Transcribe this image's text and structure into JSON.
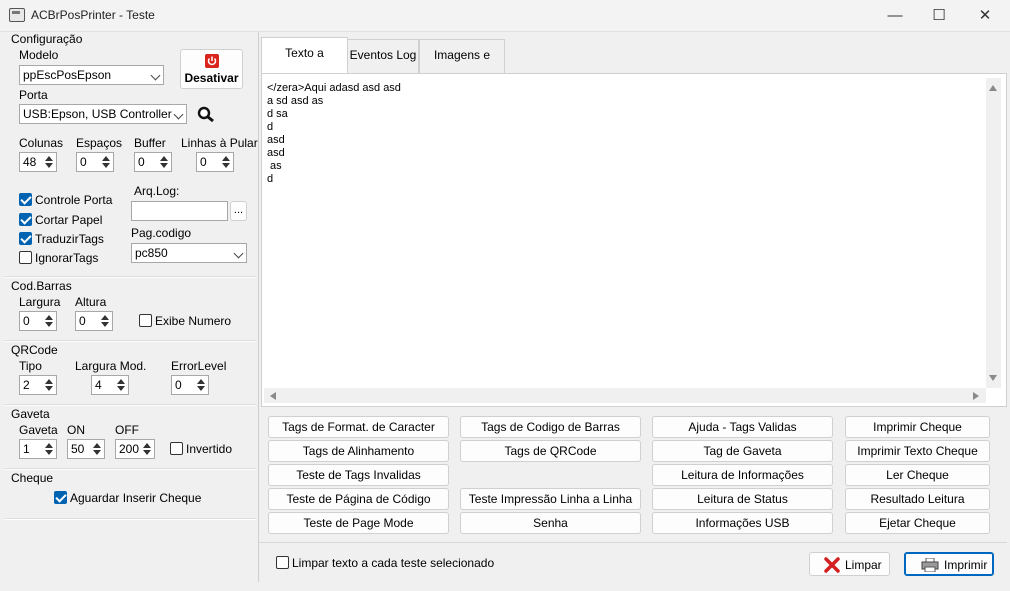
{
  "window": {
    "title": "ACBrPosPrinter - Teste",
    "minimize": "—",
    "maximize": "☐",
    "close": "✕"
  },
  "config": {
    "section_title": "Configuração",
    "modelo_label": "Modelo",
    "modelo_value": "ppEscPosEpson",
    "desativar_label": "Desativar",
    "porta_label": "Porta",
    "porta_value": "USB:Epson, USB Controller",
    "colunas_label": "Colunas",
    "colunas_value": "48",
    "espacos_label": "Espaços",
    "espacos_value": "0",
    "buffer_label": "Buffer",
    "buffer_value": "0",
    "linhas_label": "Linhas à Pular",
    "linhas_value": "0",
    "controle_porta": "Controle Porta",
    "cortar_papel": "Cortar Papel",
    "traduzir_tags": "TraduzirTags",
    "ignorar_tags": "IgnorarTags",
    "arqlog_label": "Arq.Log:",
    "arqlog_value": "",
    "browse_label": "...",
    "pagcodigo_label": "Pag.codigo",
    "pagcodigo_value": "pc850"
  },
  "codbarras": {
    "section_title": "Cod.Barras",
    "largura_label": "Largura",
    "largura_value": "0",
    "altura_label": "Altura",
    "altura_value": "0",
    "exibe_numero": "Exibe Numero"
  },
  "qrcode": {
    "section_title": "QRCode",
    "tipo_label": "Tipo",
    "tipo_value": "2",
    "largura_mod_label": "Largura Mod.",
    "largura_mod_value": "4",
    "error_level_label": "ErrorLevel",
    "error_level_value": "0"
  },
  "gaveta": {
    "section_title": "Gaveta",
    "gaveta_label": "Gaveta",
    "gaveta_value": "1",
    "on_label": "ON",
    "on_value": "50",
    "off_label": "OFF",
    "off_value": "200",
    "invertido": "Invertido"
  },
  "cheque": {
    "section_title": "Cheque",
    "aguardar": "Aguardar Inserir Cheque"
  },
  "tabs": [
    "Texto a Imprimir",
    "Eventos Log",
    "Imagens e Logo"
  ],
  "editor_lines": [
    "</zera>Aqui adasd asd asd",
    "a sd asd as",
    "d sa",
    "d",
    "asd",
    "asd",
    " as",
    "d"
  ],
  "tag_buttons": {
    "col1": [
      "Tags de Format. de Caracter",
      "Tags de Alinhamento",
      "Teste de Tags Invalidas",
      "Teste de Página de Código",
      "Teste de Page Mode"
    ],
    "col2": [
      "Tags de Codigo de Barras",
      "Tags de QRCode",
      "Teste Impressão Linha a Linha",
      "Senha"
    ],
    "col3": [
      "Ajuda - Tags Validas",
      "Tag de Gaveta",
      "Leitura de Informações",
      "Leitura de Status",
      "Informações USB"
    ],
    "col4": [
      "Imprimir Cheque",
      "Imprimir Texto Cheque",
      "Ler Cheque",
      "Resultado Leitura",
      "Ejetar Cheque"
    ]
  },
  "bottom": {
    "limpar_texto": "Limpar texto a cada teste selecionado",
    "limpar": "Limpar",
    "imprimir": "Imprimir"
  }
}
